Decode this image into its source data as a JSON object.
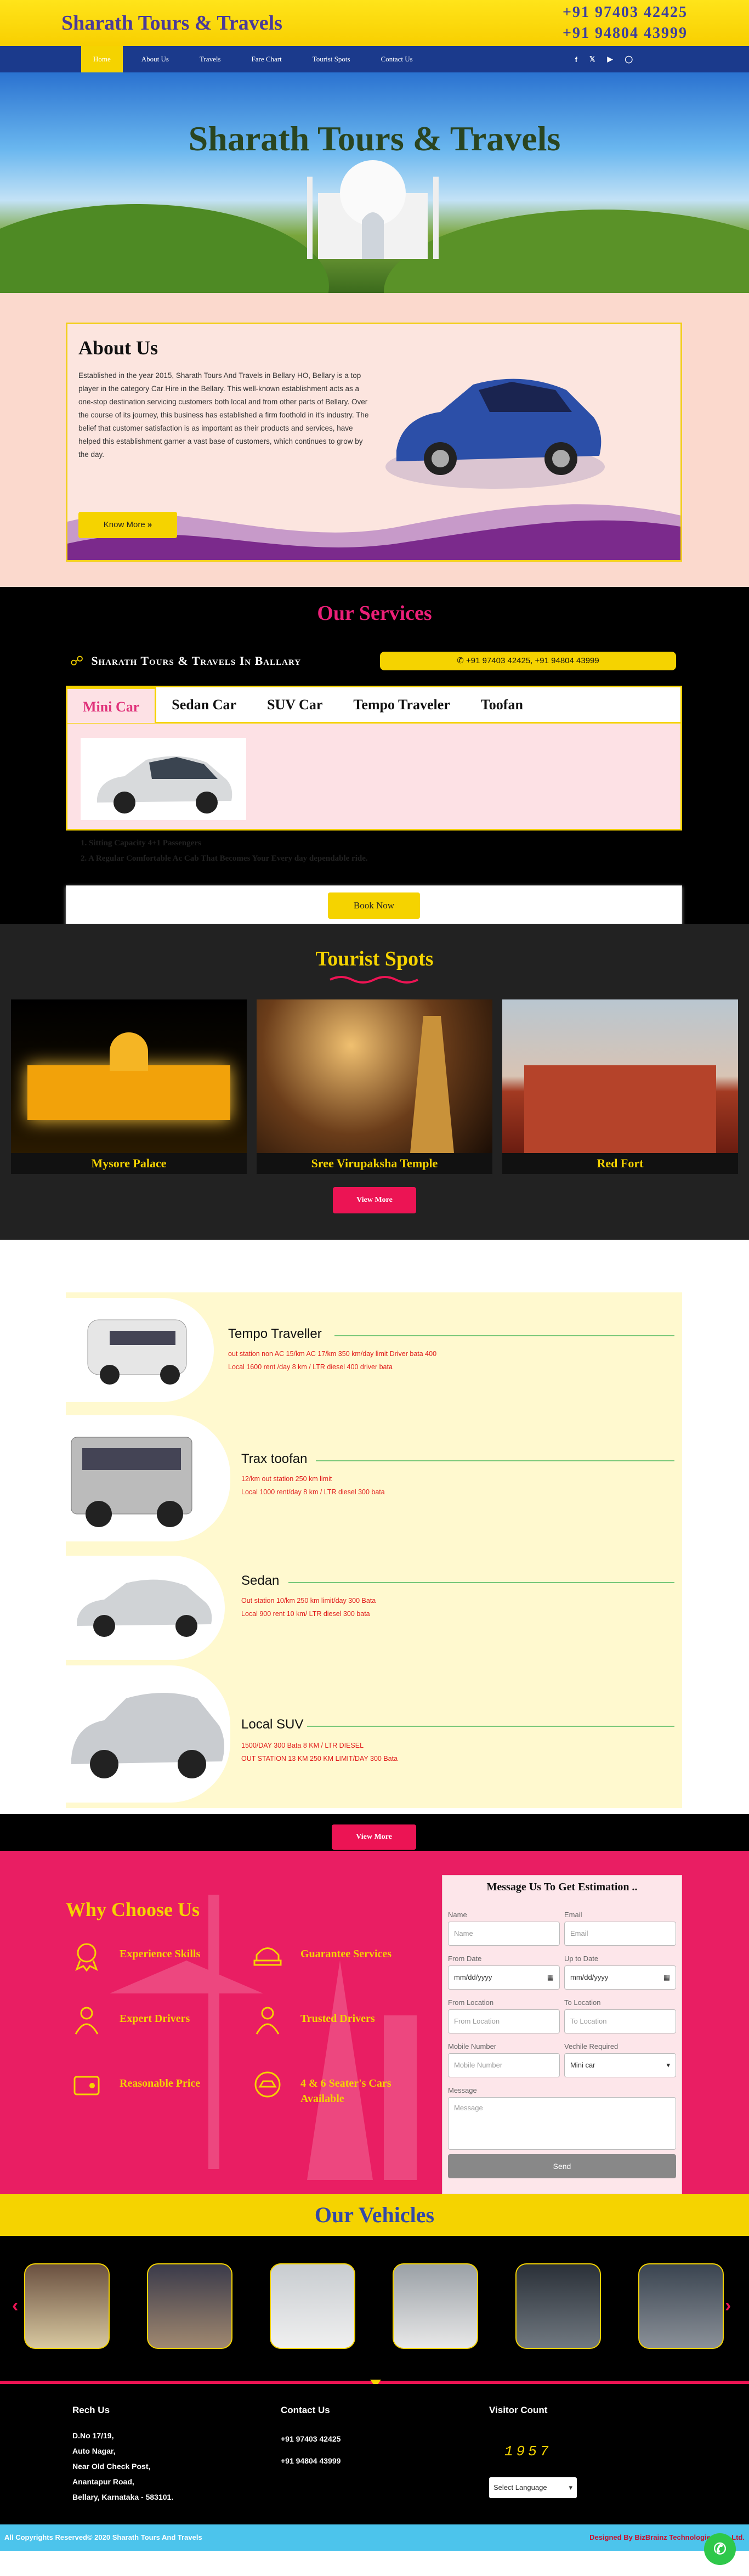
{
  "header": {
    "brand": "Sharath Tours & Travels",
    "phone1": "+91 97403 42425",
    "phone2": "+91 94804 43999"
  },
  "nav": {
    "items": [
      "Home",
      "About Us",
      "Travels",
      "Fare Chart",
      "Tourist Spots",
      "Contact Us"
    ],
    "active": "Home",
    "social_icons": [
      "facebook-icon",
      "twitter-icon",
      "youtube-icon",
      "instagram-icon"
    ]
  },
  "hero": {
    "title": "Sharath Tours & Travels"
  },
  "about": {
    "title": "About Us",
    "text": "Established in the year 2015, Sharath Tours And Travels in Bellary HO, Bellary is a top player in the category Car Hire in the Bellary. This well-known establishment acts as a one-stop destination servicing customers both local and from other parts of Bellary. Over the course of its journey, this business has established a firm foothold in it's industry. The belief that customer satisfaction is as important as their products and services, have helped this establishment garner a vast base of customers, which continues to grow by the day.",
    "button": "Know More",
    "button_icon": "»"
  },
  "services": {
    "title": "Our Services",
    "brand": "Sharath Tours & Travels In Ballary",
    "phones": "+91 97403 42425, +91 94804 43999",
    "tabs": [
      "Mini Car",
      "Sedan Car",
      "SUV Car",
      "Tempo Traveler",
      "Toofan"
    ],
    "active_tab": "Mini Car",
    "features": [
      "1. Sitting Capacity 4+1 Passengers",
      "2. A Regular Comfortable Ac Cab That Becomes Your Every day dependable ride."
    ],
    "book_button": "Book Now"
  },
  "tourist": {
    "title": "Tourist Spots",
    "spots": [
      "Mysore Palace",
      "Sree Virupaksha Temple",
      "Red Fort"
    ],
    "button": "View More"
  },
  "vehicles": {
    "items": [
      {
        "name": "Tempo Traveller",
        "lines": [
          "out station non AC 15/km AC 17/km 350 km/day limit Driver bata 400",
          "Local 1600 rent /day 8 km / LTR diesel 400 driver bata"
        ]
      },
      {
        "name": "Trax toofan",
        "lines": [
          "12/km out station 250 km limit",
          "Local 1000 rent/day 8 km / LTR diesel 300 bata"
        ]
      },
      {
        "name": "Sedan",
        "lines": [
          "Out station 10/km 250 km limit/day 300 Bata",
          "Local 900 rent 10 km/ LTR diesel 300 bata"
        ]
      },
      {
        "name": "Local SUV",
        "lines": [
          "1500/DAY 300 Bata 8 KM / LTR DIESEL",
          "OUT STATION 13 KM 250 KM LIMIT/DAY 300 Bata"
        ]
      }
    ],
    "button": "View More"
  },
  "why": {
    "title": "Why Choose Us",
    "items": [
      {
        "label": "Experience Skills",
        "icon": "skills-icon"
      },
      {
        "label": "Guarantee Services",
        "icon": "guarantee-icon"
      },
      {
        "label": "Expert Drivers",
        "icon": "driver-icon"
      },
      {
        "label": "Trusted Drivers",
        "icon": "trusted-icon"
      },
      {
        "label": "Reasonable Price",
        "icon": "price-icon"
      },
      {
        "label": "4 & 6 Seater's Cars Available",
        "icon": "car-seat-icon"
      }
    ]
  },
  "form": {
    "title": "Message Us To Get Estimation ..",
    "name_label": "Name",
    "name_ph": "Name",
    "email_label": "Email",
    "email_ph": "Email",
    "from_date_label": "From Date",
    "from_date_ph": "mm/dd/yyyy",
    "to_date_label": "Up to Date",
    "to_date_ph": "mm/dd/yyyy",
    "from_loc_label": "From Location",
    "from_loc_ph": "From Location",
    "to_loc_label": "To Location",
    "to_loc_ph": "To Location",
    "mobile_label": "Mobile Number",
    "mobile_ph": "Mobile Number",
    "vehicle_label": "Vechile Required",
    "vehicle_value": "Mini car",
    "message_label": "Message",
    "message_ph": "Message",
    "send": "Send"
  },
  "our_vehicles": {
    "title": "Our Vehicles"
  },
  "footer": {
    "reach_title": "Rech Us",
    "address": [
      "D.No 17/19,",
      "Auto Nagar,",
      "Near Old Check Post,",
      "Anantapur Road,",
      "Bellary, Karnataka - 583101."
    ],
    "contact_title": "Contact Us",
    "contact": [
      "+91 97403 42425",
      "+91 94804 43999"
    ],
    "visitor_title": "Visitor Count",
    "visitor_count": "1957",
    "language": "Select Language",
    "copyright": "All Copyrights Reserved© 2020 Sharath Tours And Travels",
    "credit": "Designed By BizBrainz Technologies Pvt. Ltd."
  },
  "colors": {
    "yellow": "#f5d300",
    "navy": "#1b3a8c",
    "pink": "#e91e63",
    "red": "#ec1454"
  }
}
